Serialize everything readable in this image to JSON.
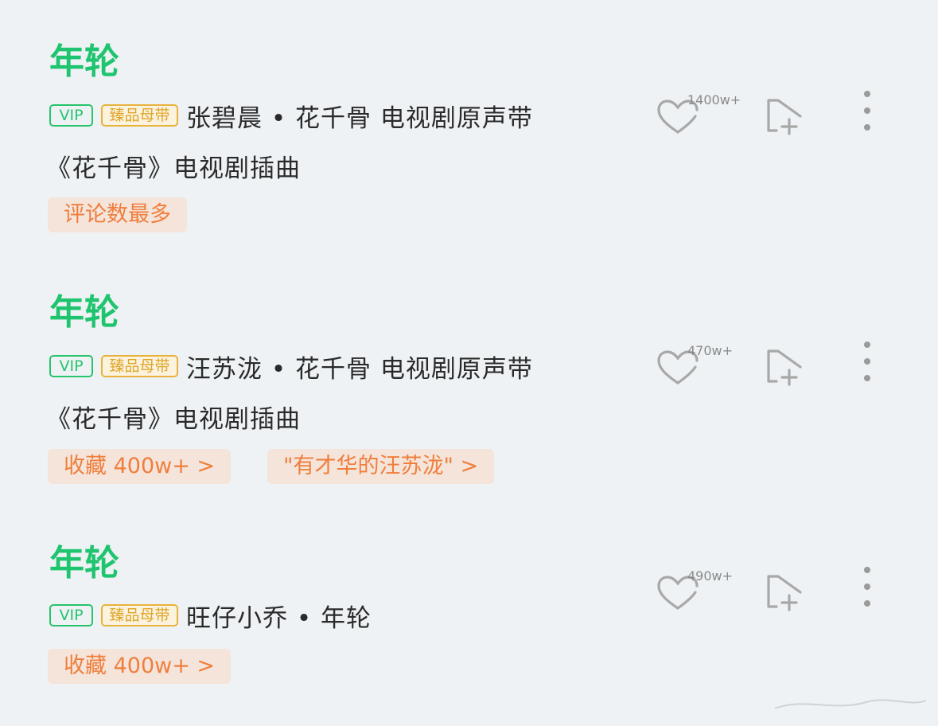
{
  "songs": [
    {
      "title": "年轮",
      "vip_badge": "VIP",
      "quality_badge": "臻品母带",
      "meta": "张碧晨 • 花千骨 电视剧原声带",
      "description": "《花千骨》电视剧插曲",
      "tags": [
        "评论数最多"
      ],
      "like_count": "1400w+"
    },
    {
      "title": "年轮",
      "vip_badge": "VIP",
      "quality_badge": "臻品母带",
      "meta": "汪苏泷 • 花千骨 电视剧原声带",
      "description": "《花千骨》电视剧插曲",
      "tags": [
        "收藏 400w+ >",
        "\"有才华的汪苏泷\" >"
      ],
      "like_count": "470w+"
    },
    {
      "title": "年轮",
      "vip_badge": "VIP",
      "quality_badge": "臻品母带",
      "meta": "旺仔小乔 • 年轮",
      "description": "",
      "tags": [
        "收藏 400w+ >"
      ],
      "like_count": "490w+"
    }
  ],
  "icons": {
    "like": "heart-outline-icon",
    "add": "add-to-playlist-icon",
    "more": "more-vertical-icon"
  },
  "colors": {
    "title_green": "#1fc46e",
    "vip_green": "#27c46c",
    "quality_gold": "#e0a52a",
    "tag_orange": "#f07e3c",
    "tag_bg": "#f4e4da",
    "background": "#eef2f5"
  }
}
